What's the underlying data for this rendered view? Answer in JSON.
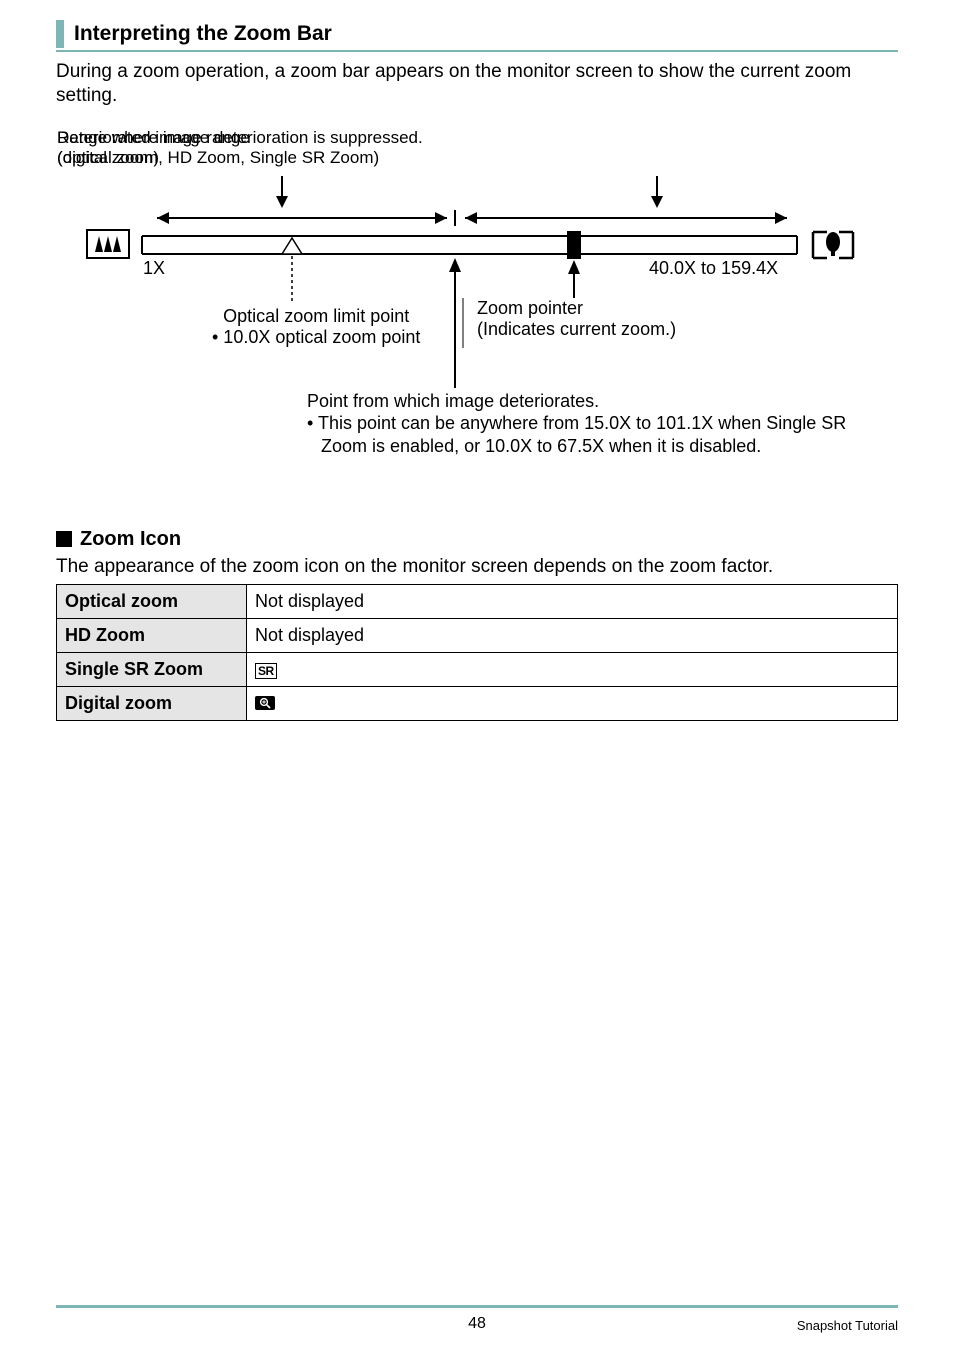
{
  "heading": "Interpreting the Zoom Bar",
  "intro": "During a zoom operation, a zoom bar appears on the monitor screen to show the current zoom setting.",
  "diagram": {
    "range_suppressed_line1": "Range where image deterioration is suppressed.",
    "range_suppressed_line2": "(optical zoom, HD Zoom, Single SR Zoom)",
    "deteriorated_line1": "Deteriorated image range",
    "deteriorated_line2": "(digital zoom)",
    "left_scale": "1X",
    "right_scale": "40.0X to 159.4X",
    "optical_limit_l1": "Optical zoom limit point",
    "optical_limit_l2": "• 10.0X optical zoom point",
    "zoom_pointer_l1": "Zoom pointer",
    "zoom_pointer_l2": "(Indicates current zoom.)",
    "deteriorate_point_l1": "Point from which image deteriorates.",
    "deteriorate_point_l2": "• This point can be anywhere from 15.0X to 101.1X when Single SR Zoom is enabled, or 10.0X to 67.5X when it is disabled."
  },
  "sub_heading": "Zoom Icon",
  "sub_intro": "The appearance of the zoom icon on the monitor screen depends on the zoom factor.",
  "table": {
    "rows": [
      {
        "label": "Optical zoom",
        "value": "Not displayed"
      },
      {
        "label": "HD Zoom",
        "value": "Not displayed"
      },
      {
        "label": "Single SR Zoom",
        "icon": "sr"
      },
      {
        "label": "Digital zoom",
        "icon": "dz"
      }
    ]
  },
  "icons": {
    "sr_text": "SR"
  },
  "footer": {
    "page": "48",
    "section": "Snapshot Tutorial"
  }
}
